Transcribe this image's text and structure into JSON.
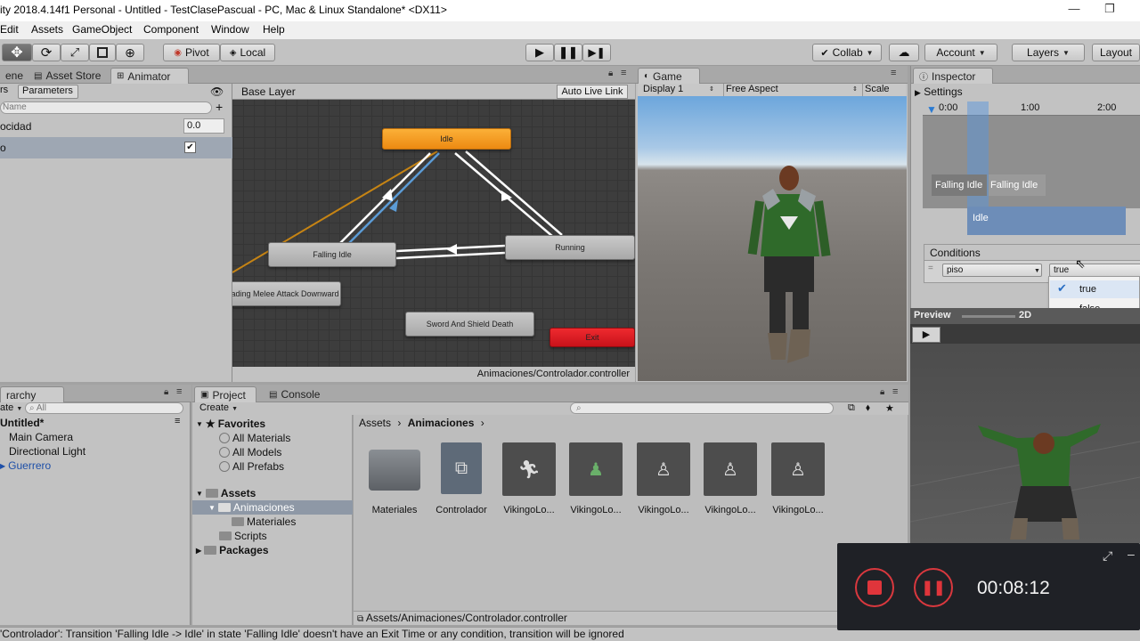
{
  "window": {
    "title": "ity 2018.4.14f1 Personal - Untitled - TestClasePascual - PC, Mac & Linux Standalone* <DX11>",
    "minimize": "—",
    "restore": "❐"
  },
  "menu": [
    "Edit",
    "Assets",
    "GameObject",
    "Component",
    "Window",
    "Help"
  ],
  "toolbar": {
    "pivot": "Pivot",
    "local": "Local",
    "collab": "Collab",
    "account": "Account",
    "layers": "Layers",
    "layout": "Layout"
  },
  "tabs": {
    "scene": "ene",
    "asset_store": "Asset Store",
    "animator": "Animator",
    "game": "Game",
    "inspector": "Inspector",
    "hierarchy": "rarchy",
    "project": "Project",
    "console": "Console"
  },
  "animator": {
    "subtab_layers": "rs",
    "subtab_parameters": "Parameters",
    "search_placeholder": "Name",
    "params": [
      {
        "name": "ocidad",
        "value": "0.0"
      },
      {
        "name": "o",
        "checked": true
      }
    ],
    "breadcrumb": "Base Layer",
    "auto_live_link": "Auto Live Link",
    "states": {
      "idle": "Idle",
      "falling_idle": "Falling Idle",
      "running": "Running",
      "melee": "ading Melee Attack Downward",
      "death": "Sword And Shield Death",
      "exit": "Exit"
    },
    "footer_path": "Animaciones/Controlador.controller"
  },
  "game": {
    "display": "Display 1",
    "aspect": "Free Aspect",
    "scale": "Scale"
  },
  "inspector": {
    "settings": "Settings",
    "timeline_ticks": [
      "0:00",
      "1:00",
      "2:00"
    ],
    "clip_falling_a": "Falling Idle",
    "clip_falling_b": "Falling Idle",
    "clip_idle": "Idle",
    "conditions_header": "Conditions",
    "condition_param": "piso",
    "condition_value": "true",
    "popup_options": [
      "true",
      "false"
    ],
    "popup_checked": "true",
    "preview_label": "Preview",
    "preview_2d": "2D"
  },
  "hierarchy": {
    "create": "ate",
    "search_placeholder": "All",
    "scene": "Untitled*",
    "items": [
      "Main Camera",
      "Directional Light",
      "Guerrero"
    ]
  },
  "project": {
    "create": "Create",
    "tree": {
      "favorites": "Favorites",
      "fav_items": [
        "All Materials",
        "All Models",
        "All Prefabs"
      ],
      "assets": "Assets",
      "animaciones": "Animaciones",
      "materiales": "Materiales",
      "scripts": "Scripts",
      "packages": "Packages"
    },
    "breadcrumb_root": "Assets",
    "breadcrumb_current": "Animaciones",
    "assets": [
      "Materiales",
      "Controlador",
      "VikingoLo...",
      "VikingoLo...",
      "VikingoLo...",
      "VikingoLo...",
      "VikingoLo..."
    ],
    "footer_path": "Assets/Animaciones/Controlador.controller"
  },
  "status": "'Controlador': Transition 'Falling Idle -> Idle' in state 'Falling Idle' doesn't have an Exit Time or any condition, transition will be ignored",
  "recorder": {
    "time": "00:08:12"
  },
  "colors": {
    "idle_state": "#f49a1a",
    "exit_state": "#d9141f",
    "selected_transition": "#5b9bd5"
  }
}
